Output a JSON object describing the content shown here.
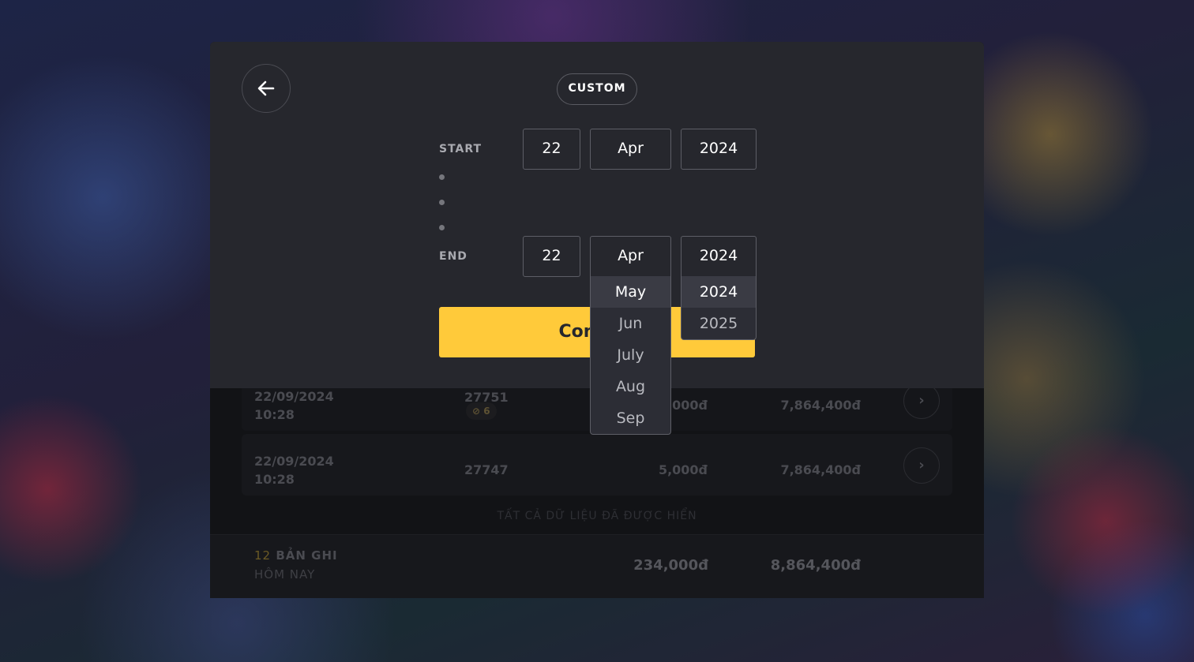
{
  "header": {
    "back_icon": "arrow-left-icon",
    "mode_label": "CUSTOM"
  },
  "range": {
    "start_label": "START",
    "end_label": "END",
    "start": {
      "day": "22",
      "month": "Apr",
      "year": "2024"
    },
    "end": {
      "day": "22",
      "month": "Apr",
      "year": "2024"
    }
  },
  "month_dropdown": {
    "options": [
      "May",
      "Jun",
      "July",
      "Aug",
      "Sep"
    ],
    "highlighted": "May"
  },
  "year_dropdown": {
    "options": [
      "2024",
      "2025"
    ],
    "highlighted": "2024"
  },
  "confirm_label": "Confirm",
  "list": {
    "rows": [
      {
        "date": "22/09/2024",
        "time": "10:28",
        "code": "27751",
        "badge": "6",
        "badge_icon": "cancel-icon",
        "amount": "5,000đ",
        "balance": "7,864,400đ"
      },
      {
        "date": "22/09/2024",
        "time": "10:28",
        "code": "27747",
        "amount": "5,000đ",
        "balance": "7,864,400đ"
      }
    ],
    "all_loaded_text": "TẤT CẢ DỮ LIỆU ĐÃ ĐƯỢC HIỂN"
  },
  "footer": {
    "count": "12",
    "count_label": "BẢN GHI",
    "period": "HÔM NAY",
    "total": "234,000đ",
    "balance": "8,864,400đ"
  }
}
